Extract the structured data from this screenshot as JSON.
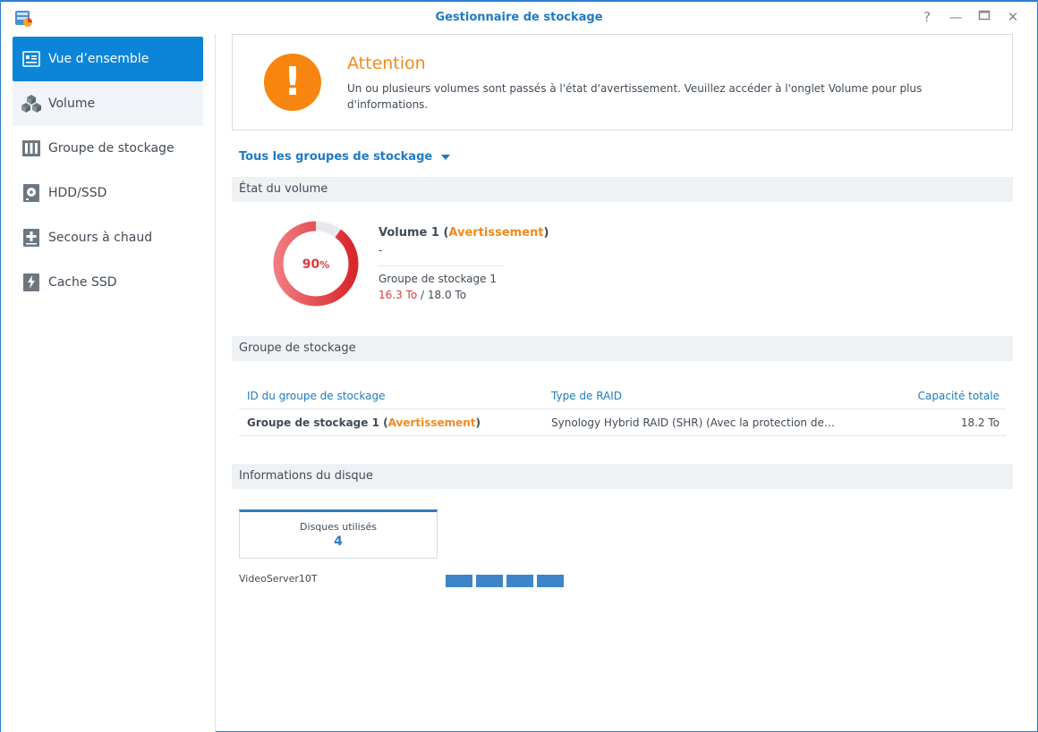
{
  "window": {
    "title": "Gestionnaire de stockage"
  },
  "sidebar": {
    "items": [
      {
        "label": "Vue d’ensemble",
        "icon": "overview-icon",
        "active": true
      },
      {
        "label": "Volume",
        "icon": "cubes-icon"
      },
      {
        "label": "Groupe de stockage",
        "icon": "storage-pool-icon"
      },
      {
        "label": "HDD/SSD",
        "icon": "hdd-icon"
      },
      {
        "label": "Secours à chaud",
        "icon": "hot-spare-icon"
      },
      {
        "label": "Cache SSD",
        "icon": "ssd-cache-icon"
      }
    ]
  },
  "alert": {
    "title": "Attention",
    "icon": "exclamation-icon",
    "message": "Un ou plusieurs volumes sont passés à l'état d'avertissement. Veuillez accéder à l'onglet Volume pour plus d'informations."
  },
  "group_filter": {
    "label": "Tous les groupes de stockage"
  },
  "volume_section": {
    "heading": "État du volume",
    "percent": "90",
    "percent_unit": "%",
    "usage_fraction": 0.9,
    "name": "Volume 1",
    "status": "Avertissement",
    "description": "-",
    "pool": "Groupe de stockage 1",
    "used": "16.3 To",
    "separator": "/",
    "total": "18.0 To"
  },
  "pool_section": {
    "heading": "Groupe de stockage",
    "columns": [
      "ID du groupe de stockage",
      "Type de RAID",
      "Capacité totale"
    ],
    "rows": [
      {
        "name": "Groupe de stockage 1",
        "status": "Avertissement",
        "raid": "Synology Hybrid RAID (SHR) (Avec la protection de…",
        "capacity": "18.2 To"
      }
    ]
  },
  "disk_section": {
    "heading": "Informations du disque",
    "used_label": "Disques utilisés",
    "used_count": "4",
    "server": "VideoServer10T",
    "disk_count": 4
  },
  "colors": {
    "accent": "#0c85d8",
    "warning": "#f28a1e",
    "danger": "#e0393e",
    "disk": "#3e84c8"
  }
}
